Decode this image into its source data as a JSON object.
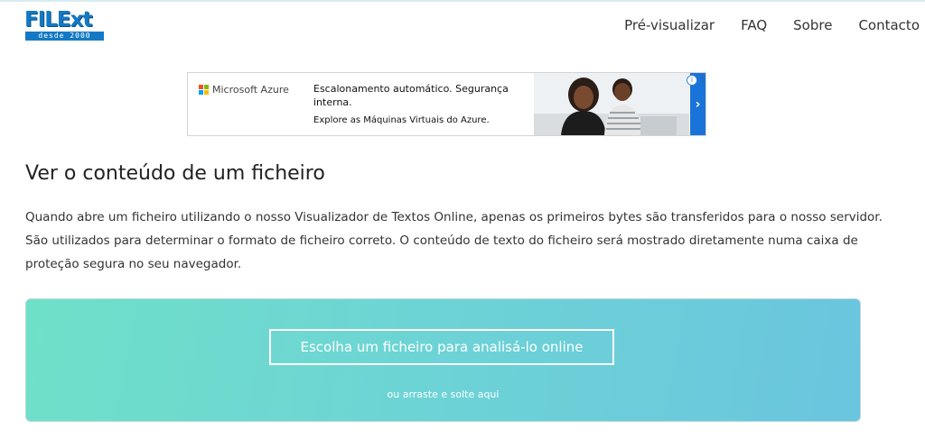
{
  "logo": {
    "main": "FILExt",
    "sub": "desde 2000"
  },
  "nav": {
    "items": [
      "Pré-visualizar",
      "FAQ",
      "Sobre",
      "Contacto"
    ]
  },
  "ad": {
    "brand": "Microsoft Azure",
    "headline": "Escalonamento automático. Segurança interna.",
    "subline": "Explore as Máquinas Virtuais do Azure.",
    "info_icon": "info-icon",
    "close_icon": "close-icon",
    "arrow_icon": "chevron-right-icon",
    "brand_colors": [
      "#f25022",
      "#7fba00",
      "#00a4ef",
      "#ffb900"
    ]
  },
  "main": {
    "title": "Ver o conteúdo de um ficheiro",
    "description": "Quando abre um ficheiro utilizando o nosso Visualizador de Textos Online, apenas os primeiros bytes são transferidos para o nosso servidor. São utilizados para determinar o formato de ficheiro correto. O conteúdo de texto do ficheiro será mostrado diretamente numa caixa de proteção segura no seu navegador."
  },
  "dropzone": {
    "button_label": "Escolha um ficheiro para analisá-lo online",
    "hint": "ou arraste e solte aqui"
  },
  "colors": {
    "brand_blue": "#1479c4",
    "dropzone_start": "#6fe0c8",
    "dropzone_end": "#6ac5de",
    "ad_arrow": "#1a73d9"
  }
}
